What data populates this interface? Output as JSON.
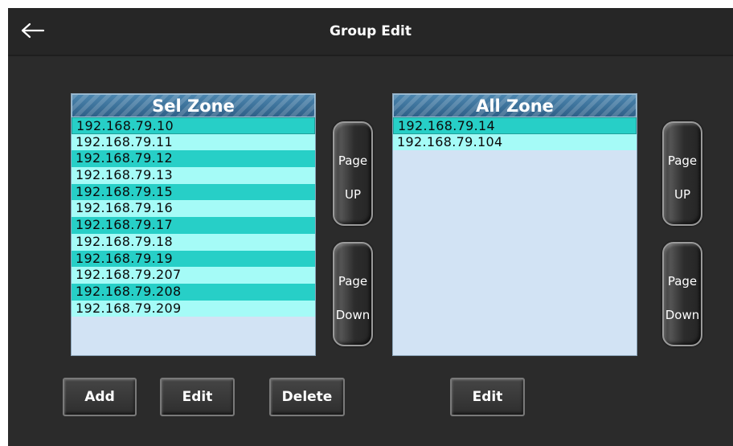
{
  "header": {
    "title": "Group Edit",
    "back_icon": "back-arrow-icon"
  },
  "sel_zone": {
    "title": "Sel Zone",
    "items": [
      "192.168.79.10",
      "192.168.79.11",
      "192.168.79.12",
      "192.168.79.13",
      "192.168.79.15",
      "192.168.79.16",
      "192.168.79.17",
      "192.168.79.18",
      "192.168.79.19",
      "192.168.79.207",
      "192.168.79.208",
      "192.168.79.209"
    ]
  },
  "all_zone": {
    "title": "All Zone",
    "items": [
      "192.168.79.14",
      "192.168.79.104"
    ]
  },
  "paging": {
    "up_line1": "Page",
    "up_line2": "UP",
    "down_line1": "Page",
    "down_line2": "Down"
  },
  "buttons": {
    "add": "Add",
    "edit": "Edit",
    "delete": "Delete",
    "edit_all": "Edit"
  },
  "colors": {
    "background": "#2b2b2b",
    "row_dark": "#27cfc7",
    "row_light": "#a5fbf7",
    "list_background": "#d2e3f4",
    "header_blue": "#3e75a0"
  }
}
